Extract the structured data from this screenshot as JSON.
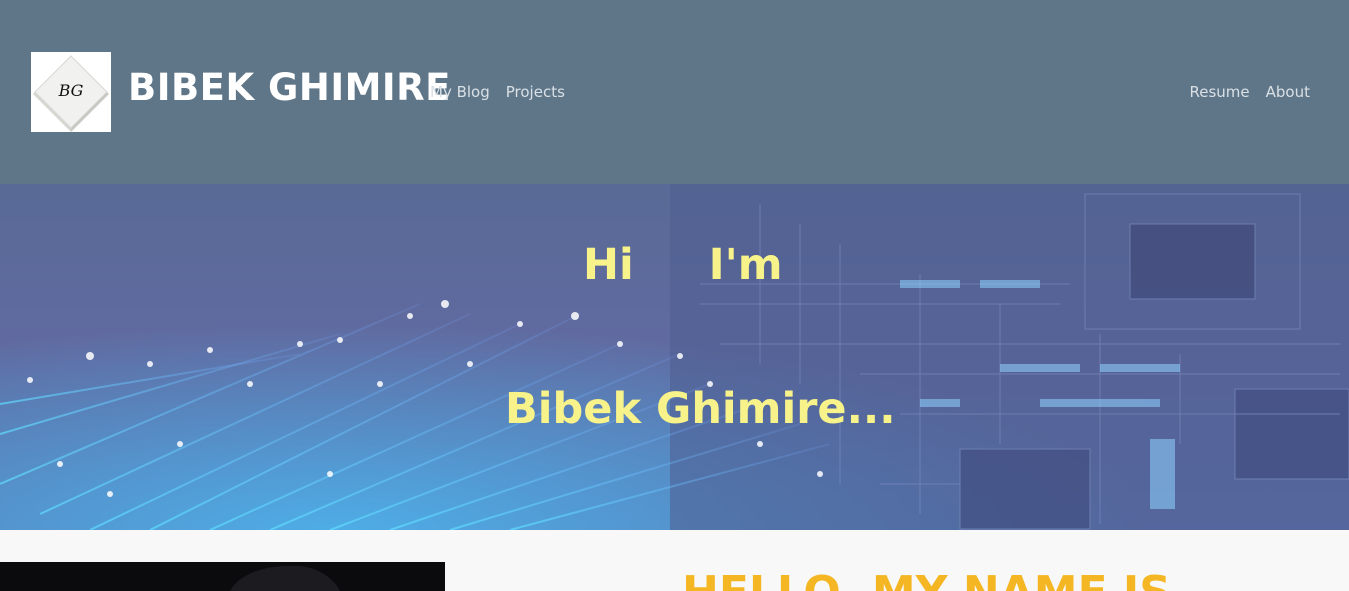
{
  "header": {
    "logo_text": "BG",
    "brand": "BIBEK GHIMIRE",
    "nav_left": [
      {
        "label": "My Blog"
      },
      {
        "label": "Projects"
      }
    ],
    "nav_right": [
      {
        "label": "Resume"
      },
      {
        "label": "About"
      }
    ]
  },
  "hero": {
    "line1": "Hi     I'm",
    "line2": "Bibek Ghimire..."
  },
  "about": {
    "heading": "HELLO, MY NAME IS"
  },
  "colors": {
    "header_bg": "#5f7688",
    "hero_text": "#f7f28a",
    "heading_accent": "#f4b623"
  }
}
